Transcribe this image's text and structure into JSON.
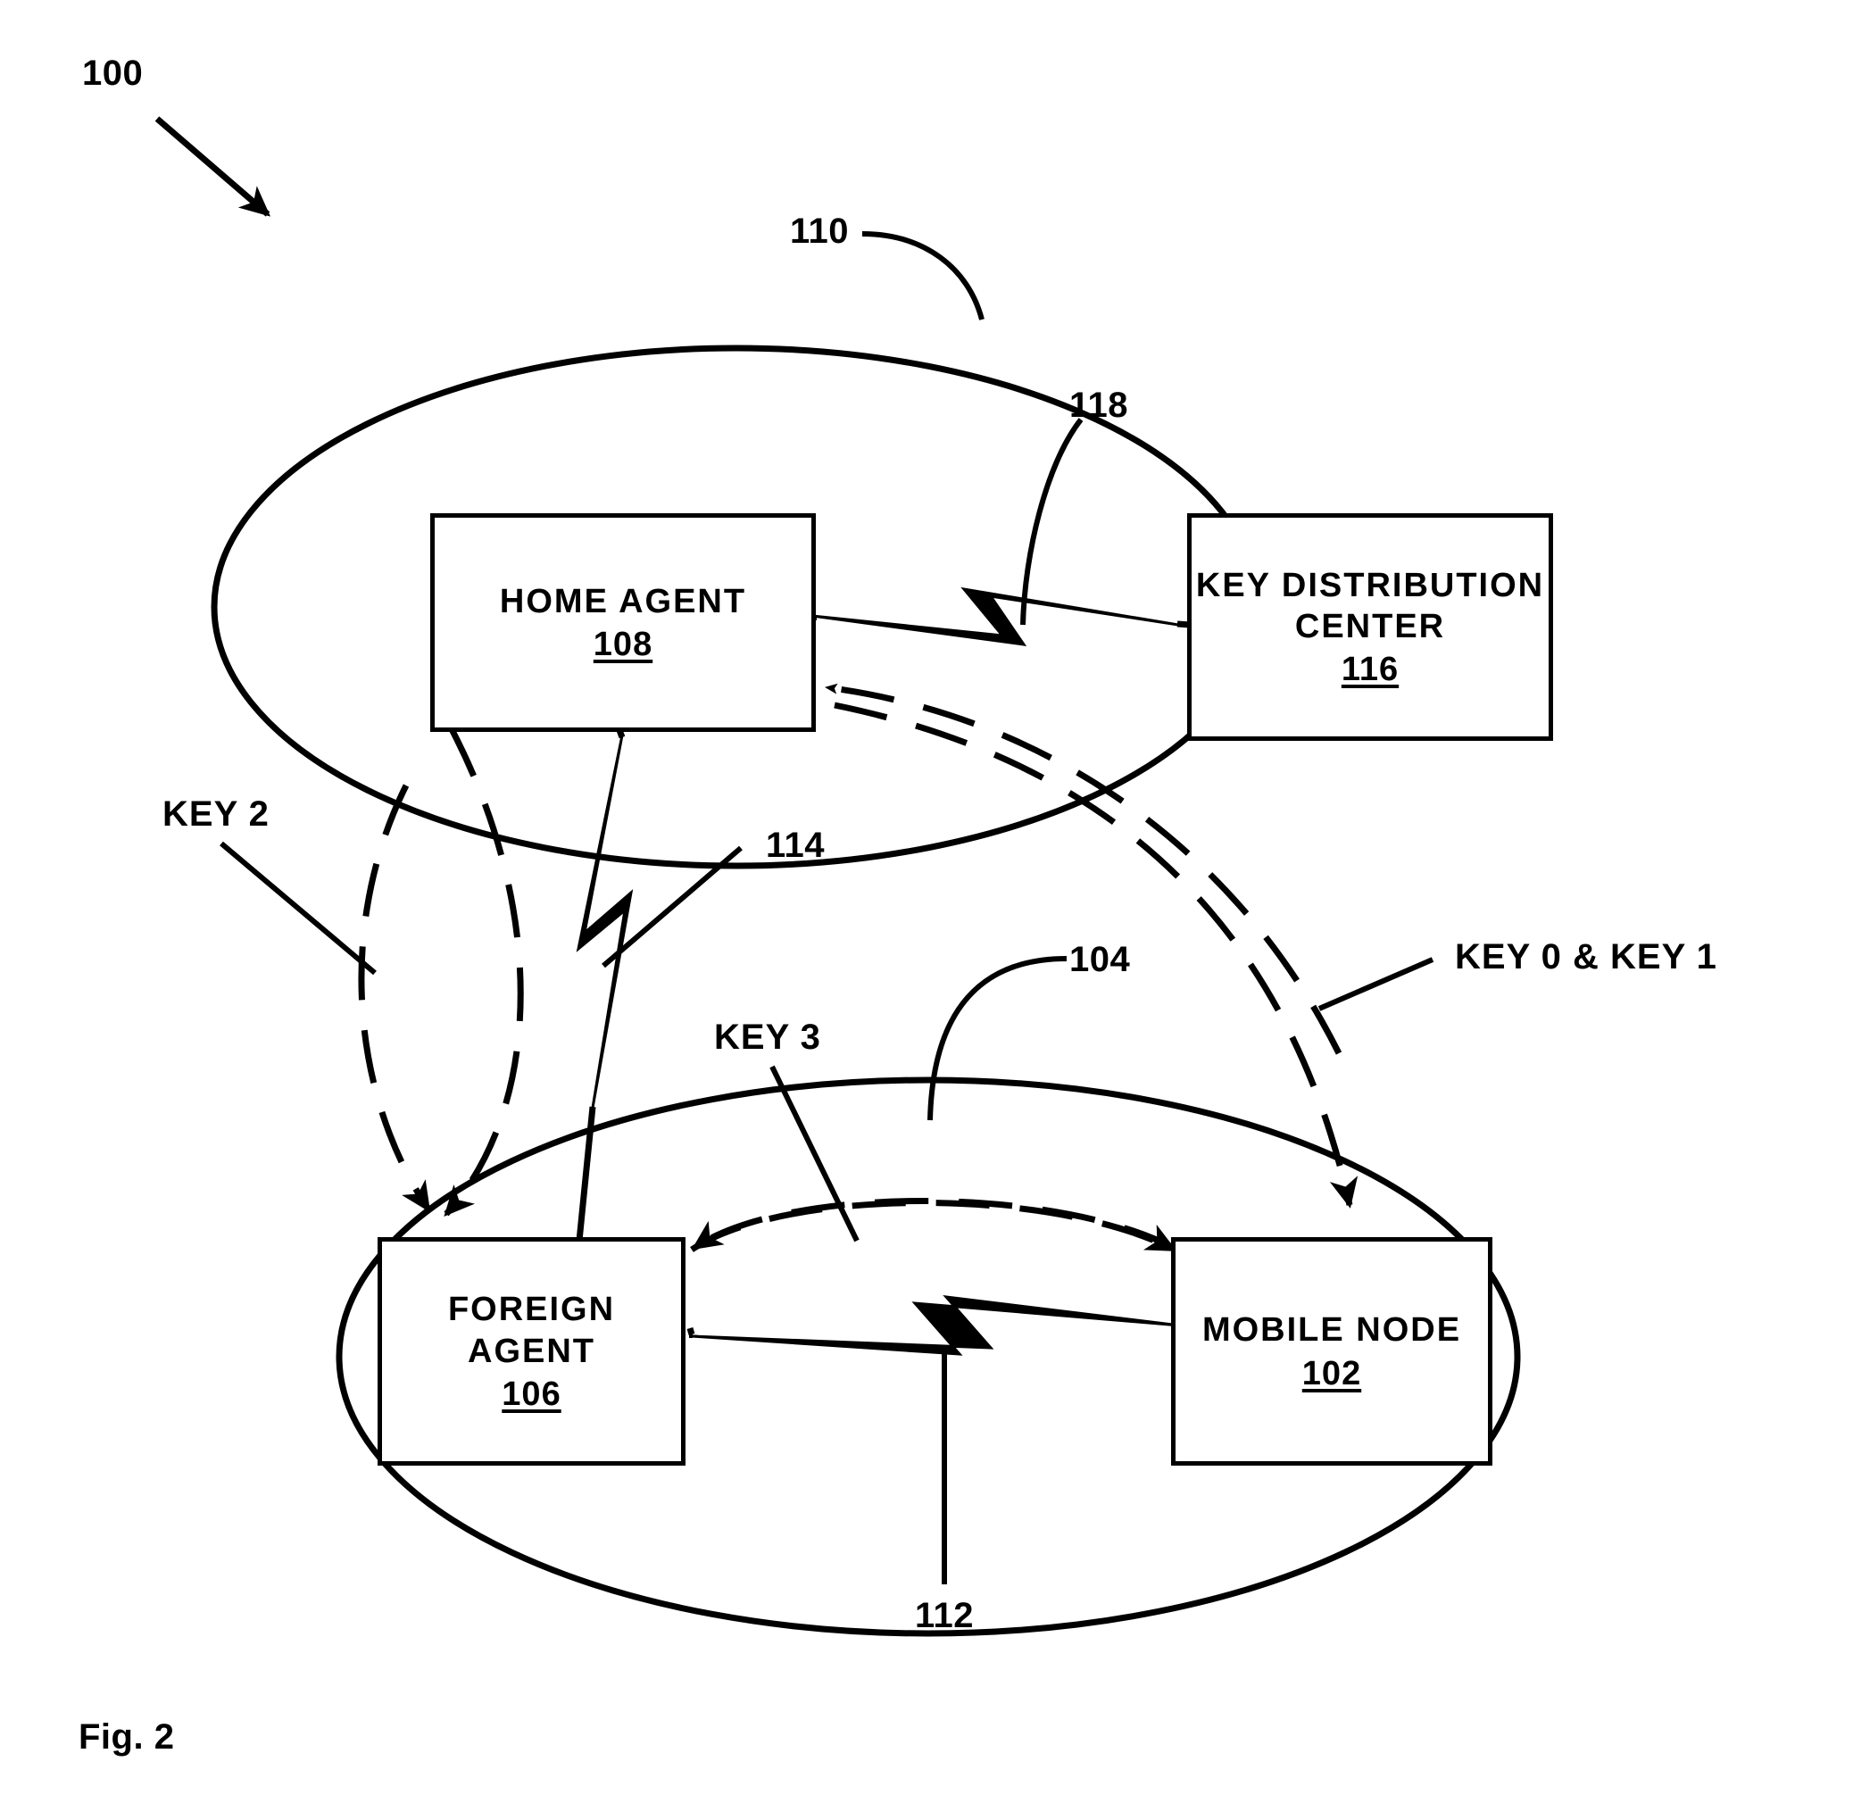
{
  "figure": {
    "caption": "Fig. 2",
    "system_ref": "100"
  },
  "networks": [
    {
      "name": "home-network",
      "ref": "110"
    },
    {
      "name": "foreign-network",
      "ref": "104"
    }
  ],
  "nodes": [
    {
      "id": "home-agent",
      "title": "HOME AGENT",
      "ref": "108"
    },
    {
      "id": "key-distribution-center",
      "title_line1": "KEY DISTRIBUTION",
      "title_line2": "CENTER",
      "ref": "116"
    },
    {
      "id": "foreign-agent",
      "title_line1": "FOREIGN",
      "title_line2": "AGENT",
      "ref": "106"
    },
    {
      "id": "mobile-node",
      "title": "MOBILE NODE",
      "ref": "102"
    }
  ],
  "links": [
    {
      "id": "kdc-to-home-agent",
      "ref": "118",
      "style": "lightning"
    },
    {
      "id": "home-agent-to-foreign-agent",
      "ref": "114",
      "style": "lightning"
    },
    {
      "id": "foreign-agent-to-mobile-node",
      "ref": "112",
      "style": "lightning"
    }
  ],
  "key_labels": [
    {
      "id": "key-2",
      "text": "KEY 2"
    },
    {
      "id": "key-3",
      "text": "KEY 3"
    },
    {
      "id": "key-0-and-key-1",
      "text": "KEY 0 & KEY 1"
    }
  ],
  "colors": {
    "stroke": "#000000",
    "background": "#ffffff"
  }
}
